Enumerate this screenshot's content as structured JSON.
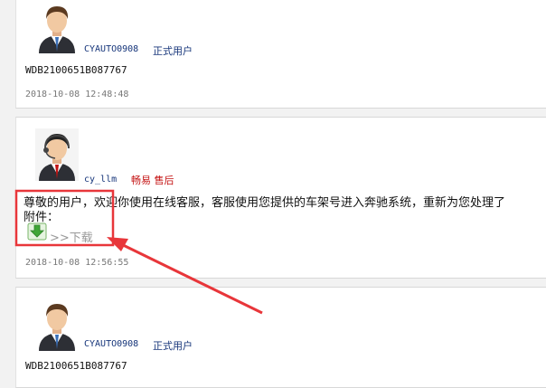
{
  "posts": [
    {
      "username": "CYAUTO0908",
      "role": "正式用户",
      "message": "WDB2100651B087767",
      "time": "2018-10-08 12:48:48"
    },
    {
      "username": "cy_llm",
      "role": "畅易 售后",
      "message": "尊敬的用户，欢迎你使用在线客服，客服使用您提供的车架号进入奔驰系统，重新为您处理了",
      "attachment_label": "附件：",
      "download_label": ">>下载",
      "time": "2018-10-08 12:56:55"
    },
    {
      "username": "CYAUTO0908",
      "role": "正式用户",
      "message": "WDB2100651B087767"
    }
  ],
  "colors": {
    "link": "#16357a",
    "staff_role": "#c41212",
    "annotation": "#e8363a"
  }
}
